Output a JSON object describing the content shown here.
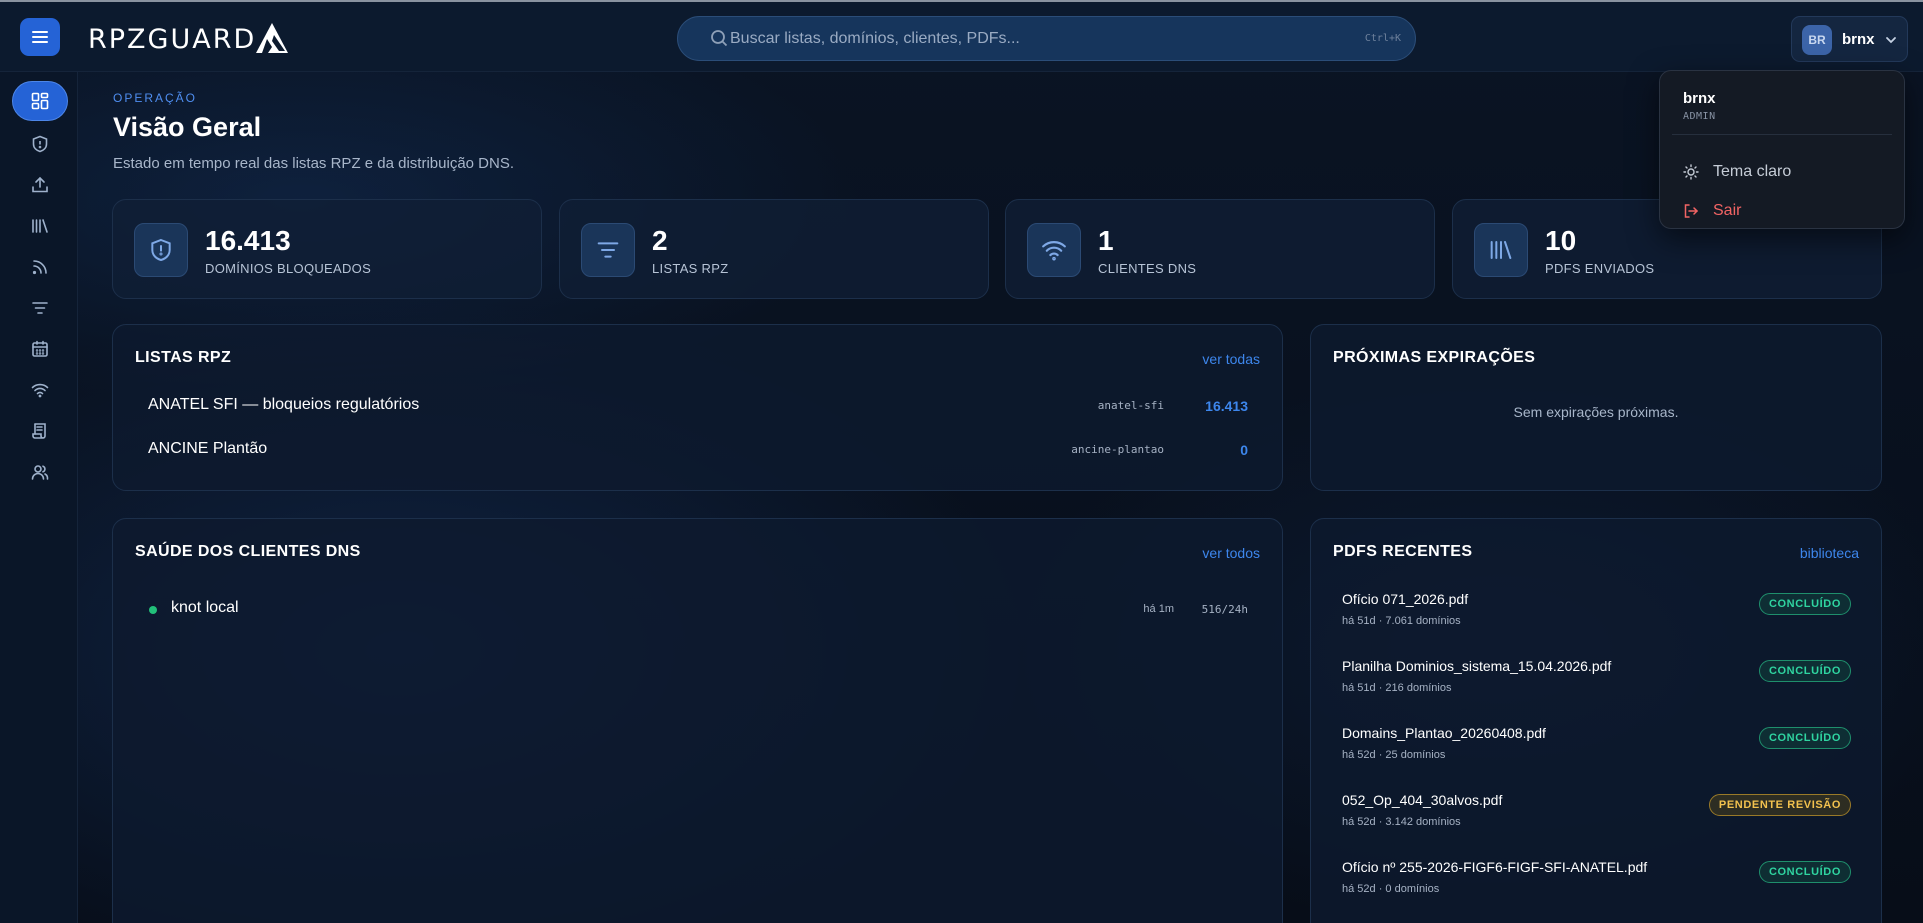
{
  "app": {
    "brand": "RPZGUARD"
  },
  "search": {
    "placeholder": "Buscar listas, domínios, clientes, PDFs...",
    "shortcut": "Ctrl+K"
  },
  "user": {
    "initials": "BR",
    "name": "brnx",
    "role": "ADMIN"
  },
  "user_menu": {
    "theme_label": "Tema claro",
    "logout_label": "Sair"
  },
  "sidebar": {
    "items": [
      {
        "icon": "dashboard-icon",
        "active": true
      },
      {
        "icon": "shield-icon",
        "active": false
      },
      {
        "icon": "upload-icon",
        "active": false
      },
      {
        "icon": "library-icon",
        "active": false
      },
      {
        "icon": "rss-icon",
        "active": false
      },
      {
        "icon": "filter-icon",
        "active": false
      },
      {
        "icon": "calendar-icon",
        "active": false
      },
      {
        "icon": "wifi-icon",
        "active": false
      },
      {
        "icon": "scroll-icon",
        "active": false
      },
      {
        "icon": "users-icon",
        "active": false
      }
    ]
  },
  "header": {
    "eyebrow": "OPERAÇÃO",
    "title": "Visão Geral",
    "subtitle": "Estado em tempo real das listas RPZ e da distribuição DNS."
  },
  "stats": [
    {
      "icon": "shield-icon",
      "value": "16.413",
      "label": "DOMÍNIOS BLOQUEADOS"
    },
    {
      "icon": "filter-icon",
      "value": "2",
      "label": "LISTAS RPZ"
    },
    {
      "icon": "wifi-icon",
      "value": "1",
      "label": "CLIENTES DNS"
    },
    {
      "icon": "library-icon",
      "value": "10",
      "label": "PDFS ENVIADOS"
    }
  ],
  "rpz_lists": {
    "title": "LISTAS RPZ",
    "link": "ver todas",
    "rows": [
      {
        "name": "ANATEL SFI — bloqueios regulatórios",
        "slug": "anatel-sfi",
        "count": "16.413"
      },
      {
        "name": "ANCINE Plantão",
        "slug": "ancine-plantao",
        "count": "0"
      }
    ]
  },
  "expirations": {
    "title": "PRÓXIMAS EXPIRAÇÕES",
    "empty": "Sem expirações próximas."
  },
  "dns_health": {
    "title": "SAÚDE DOS CLIENTES DNS",
    "link": "ver todos",
    "rows": [
      {
        "name": "knot local",
        "ago": "há 1m",
        "rate": "516/24h",
        "status_color": "#22c07a"
      }
    ]
  },
  "recent_pdfs": {
    "title": "PDFS RECENTES",
    "link": "biblioteca",
    "rows": [
      {
        "file": "Ofício 071_2026.pdf",
        "meta": "há 51d · 7.061 domínios",
        "status": "CONCLUÍDO",
        "kind": "ok"
      },
      {
        "file": "Planilha Dominios_sistema_15.04.2026.pdf",
        "meta": "há 51d · 216 domínios",
        "status": "CONCLUÍDO",
        "kind": "ok"
      },
      {
        "file": "Domains_Plantao_20260408.pdf",
        "meta": "há 52d · 25 domínios",
        "status": "CONCLUÍDO",
        "kind": "ok"
      },
      {
        "file": "052_Op_404_30alvos.pdf",
        "meta": "há 52d · 3.142 domínios",
        "status": "PENDENTE REVISÃO",
        "kind": "pend"
      },
      {
        "file": "Ofício nº 255-2026-FIGF6-FIGF-SFI-ANATEL.pdf",
        "meta": "há 52d · 0 domínios",
        "status": "CONCLUÍDO",
        "kind": "ok"
      }
    ]
  },
  "colors": {
    "accent": "#2563d6",
    "link": "#3d86ec",
    "ok": "#2fd4a0",
    "pending": "#f2c14e",
    "danger": "#f26464"
  }
}
